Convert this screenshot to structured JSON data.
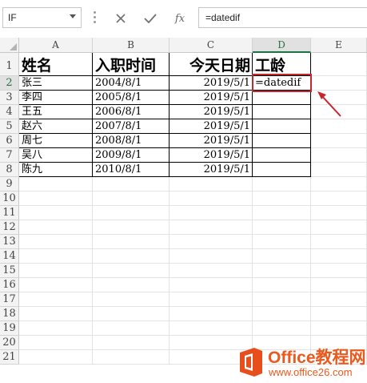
{
  "name_box": {
    "value": "IF"
  },
  "formula_bar": {
    "cancel_icon": "close-icon",
    "enter_icon": "check-icon",
    "fx_label": "fx",
    "content": "=datedif"
  },
  "columns": [
    "A",
    "B",
    "C",
    "D",
    "E"
  ],
  "active_column": "D",
  "active_row": 2,
  "rows": [
    "1",
    "2",
    "3",
    "4",
    "5",
    "6",
    "7",
    "8",
    "9",
    "10",
    "11",
    "12",
    "13",
    "14",
    "15",
    "16",
    "17",
    "18",
    "19",
    "20",
    "21"
  ],
  "table": {
    "headers": [
      "姓名",
      "入职时间",
      "今天日期",
      "工龄"
    ],
    "records": [
      {
        "name": "张三",
        "hire_date": "2004/8/1",
        "today": "2019/5/1",
        "seniority": "=datedif"
      },
      {
        "name": "李四",
        "hire_date": "2005/8/1",
        "today": "2019/5/1",
        "seniority": ""
      },
      {
        "name": "王五",
        "hire_date": "2006/8/1",
        "today": "2019/5/1",
        "seniority": ""
      },
      {
        "name": "赵六",
        "hire_date": "2007/8/1",
        "today": "2019/5/1",
        "seniority": ""
      },
      {
        "name": "周七",
        "hire_date": "2008/8/1",
        "today": "2019/5/1",
        "seniority": ""
      },
      {
        "name": "吴八",
        "hire_date": "2009/8/1",
        "today": "2019/5/1",
        "seniority": ""
      },
      {
        "name": "陈九",
        "hire_date": "2010/8/1",
        "today": "2019/5/1",
        "seniority": ""
      }
    ]
  },
  "annotation": {
    "color": "#c8262c",
    "arrow": "red-arrow"
  },
  "watermark": {
    "title": "Office教程网",
    "url": "www.office26.com",
    "color": "#ea5a1e"
  }
}
